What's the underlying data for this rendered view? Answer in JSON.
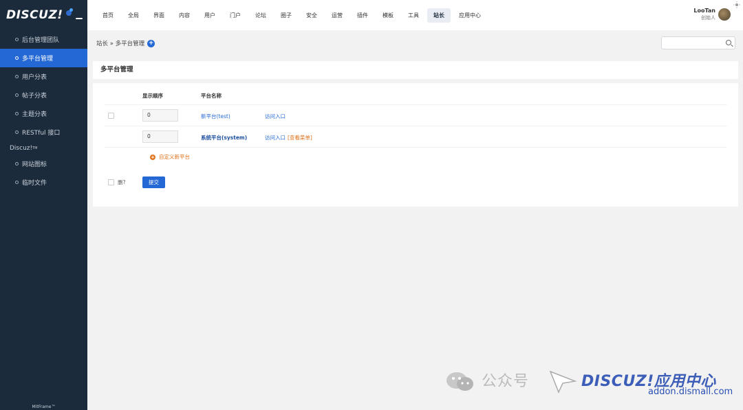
{
  "brand": {
    "logo_text": "DISCUZ!"
  },
  "sidebar": {
    "items": [
      {
        "label": "后台管理团队"
      },
      {
        "label": "多平台管理",
        "active": true
      },
      {
        "label": "用户分表"
      },
      {
        "label": "帖子分表"
      },
      {
        "label": "主题分表"
      },
      {
        "label": "RESTful 接口"
      }
    ],
    "group_label": "Discuz!",
    "group_sup": "TM",
    "group_items": [
      {
        "label": "网站图标"
      },
      {
        "label": "临时文件"
      }
    ],
    "footer": "MitFrame™"
  },
  "topnav": {
    "items": [
      "首页",
      "全局",
      "界面",
      "内容",
      "用户",
      "门户",
      "论坛",
      "圈子",
      "安全",
      "运营",
      "插件",
      "模板",
      "工具",
      "站长",
      "应用中心"
    ],
    "active": "站长"
  },
  "user": {
    "name": "LooTan",
    "role": "创始人"
  },
  "breadcrumb": {
    "text": "站长 » 多平台管理"
  },
  "search": {
    "placeholder": "",
    "value": ""
  },
  "panel": {
    "title": "多平台管理",
    "columns": {
      "order": "显示顺序",
      "name": "平台名称"
    },
    "rows": [
      {
        "order": "0",
        "name": "新平台(test)",
        "link": "访问入口",
        "extra": "",
        "checkbox": true
      },
      {
        "order": "0",
        "name": "系统平台(system)",
        "link": "访问入口",
        "extra": "[查看菜单]",
        "checkbox": false
      }
    ],
    "add_label": "自定义新平台",
    "delete_label": "删?",
    "submit_label": "提交"
  },
  "watermark": {
    "wechat": "公众号",
    "brand": "DISCUZ!应用中心",
    "url": "addon.dismall.com"
  },
  "colors": {
    "sidebar_bg": "#1c2b3c",
    "accent": "#2468d6",
    "orange": "#e0721c"
  }
}
